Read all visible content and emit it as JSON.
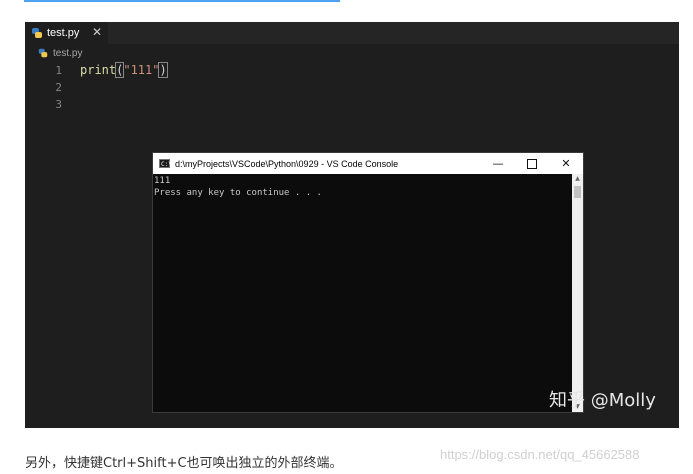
{
  "editor": {
    "tab": {
      "filename": "test.py",
      "close_symbol": "✕",
      "icon": "python-icon"
    },
    "breadcrumb": {
      "filename": "test.py",
      "icon": "python-icon"
    },
    "line_numbers": [
      "1",
      "2",
      "3"
    ],
    "code": {
      "line1": {
        "function": "print",
        "open_paren": "(",
        "string": "\"111\"",
        "close_paren": ")"
      }
    }
  },
  "console": {
    "title": "d:\\myProjects\\VSCode\\Python\\0929 - VS Code Console",
    "icon": "cmd-icon",
    "icon_text": "C:\\",
    "minimize_symbol": "—",
    "close_symbol": "✕",
    "output_lines": [
      "111",
      "Press any key to continue . . ."
    ]
  },
  "watermark": {
    "zhihu": "知乎 @Molly",
    "url": "https://blog.csdn.net/qq_45662588"
  },
  "caption": "另外，快捷键Ctrl+Shift+C也可唤出独立的外部终端。",
  "colors": {
    "editor_bg": "#1e1e1e",
    "tabbar_bg": "#252526",
    "console_bg": "#0c0c0c",
    "function_color": "#dcdcaa",
    "string_color": "#ce9178",
    "link_underline": "#4ea1f3"
  }
}
